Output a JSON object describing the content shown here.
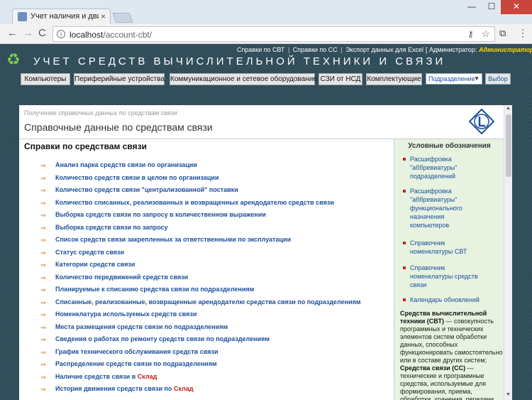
{
  "browser": {
    "tab_title": "Учет наличия и движен",
    "tab_close": "×",
    "url_host": "localhost",
    "url_path": "/account-cbt/",
    "win_min": "—",
    "win_max": "☐",
    "win_close": "✕",
    "back": "←",
    "forward": "→",
    "reload": "C",
    "info": "i",
    "key": "⚷",
    "star": "☆",
    "ext": "⧉",
    "menu": "⋮"
  },
  "header": {
    "links": [
      "Справки по СВТ",
      "Справки по СС",
      "Экспорт данных для Excel"
    ],
    "link_sep": "|",
    "admin_prefix": "[ Администратор:",
    "admin_name": "Администратор",
    "admin_suffix": "]",
    "app_title": "УЧЕТ СРЕДСТВ ВЫЧИСЛИТЕЛЬНОЙ ТЕХНИКИ И СВЯЗИ",
    "recycle": "♻"
  },
  "nav": {
    "items": [
      "Компьютеры",
      "Периферийные устройства",
      "Коммуникационное и сетевое оборудование",
      "СЗИ от НСД",
      "Комплектующие"
    ],
    "select_value": "Подразделение",
    "select_chev": "▼",
    "go_label": "Выбор"
  },
  "content": {
    "breadcrumb": "Получение справочных данных по средствам связи",
    "title": "Справочные данные по средствам связи",
    "section_title": "Справки по средствам связи",
    "arrow": "⇒",
    "links": [
      {
        "text": "Анализ парка средств связи по организации",
        "red": ""
      },
      {
        "text": "Количество средств связи в целом по организации",
        "red": ""
      },
      {
        "text": "Количество средств связи \"централизованной\" поставки",
        "red": ""
      },
      {
        "text": "Количество списанных, реализованных и возвращенных арендодателю средств связи",
        "red": ""
      },
      {
        "text": "Выборка средств связи по запросу в количественном выражении",
        "red": ""
      },
      {
        "text": "Выборка средств связи по запросу",
        "red": ""
      },
      {
        "text": "Список средств связи закрепленных за ответственными по эксплуатации",
        "red": ""
      },
      {
        "text": "Статус средств связи",
        "red": ""
      },
      {
        "text": "Категории средств связи",
        "red": ""
      },
      {
        "text": "Количество передвижений средств связи",
        "red": ""
      },
      {
        "text": "Планируемые к списанию средства связи по подразделениям",
        "red": ""
      },
      {
        "text": "Списанные, реализованные, возвращенные арендодателю средства связи по подразделениям",
        "red": ""
      },
      {
        "text": "Номенклатура используемых средств связи",
        "red": ""
      },
      {
        "text": "Места размещения средств связи по подразделениям",
        "red": ""
      },
      {
        "text": "Сведения о работах по ремонту средств связи по подразделениям",
        "red": ""
      },
      {
        "text": "График технического обслуживания средств связи",
        "red": ""
      },
      {
        "text": "Распределение средств связи по подразделениям",
        "red": ""
      },
      {
        "text": "Наличие средств связи в ",
        "red": "Склад"
      },
      {
        "text": "История движения средств связи по ",
        "red": "Склад"
      }
    ]
  },
  "sidebar": {
    "title": "Условные обозначения",
    "items": [
      [
        "Расшифровка",
        "\"аббревиатуры\"",
        "подразделений"
      ],
      [
        "Расшифровка",
        "\"аббревиатуры\"",
        "функционального",
        "назначения",
        "компьютеров"
      ],
      [
        "Справочник",
        "номенклатуры СВТ"
      ],
      [
        "Справочник",
        "номенклатуры средств",
        "связи"
      ],
      [
        "Календарь обновлений"
      ]
    ],
    "def1_term": "Средства вычислительной техники (СВТ)",
    "def1_text": " — совокупность программных и технических элементов систем обработки данных, способных функционировать самостоятельно или в составе других систем;",
    "def2_term": "Средства связи (СС)",
    "def2_text": " — технические и программные средства, используемые для формирования, приема, обработки, хранения, передачи,"
  },
  "scroll": {
    "up": "▲",
    "down": "▼"
  }
}
